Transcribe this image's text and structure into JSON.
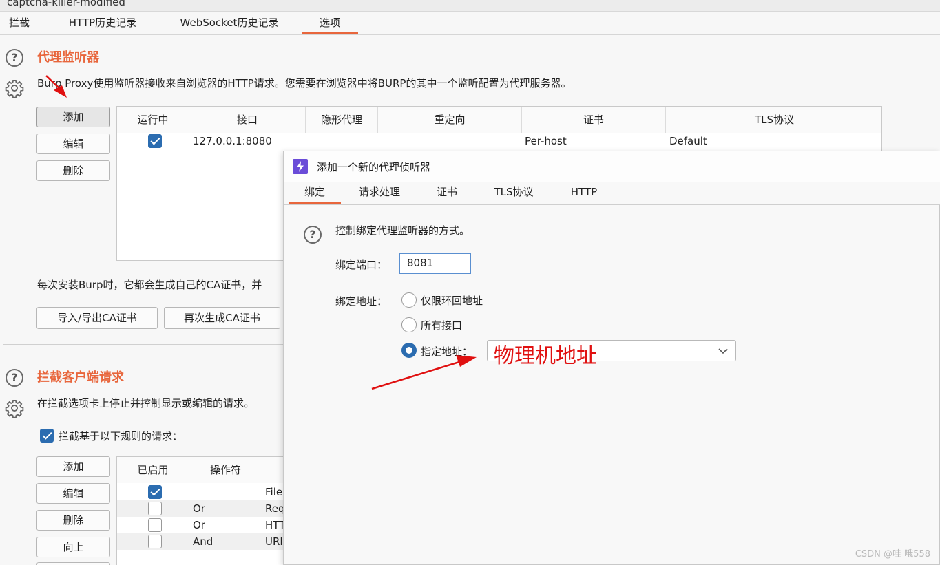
{
  "window_title": "captcha-killer-modified",
  "main_tabs": [
    "拦截",
    "HTTP历史记录",
    "WebSocket历史记录",
    "选项"
  ],
  "proxy_listeners": {
    "title": "代理监听器",
    "desc": "Burp Proxy使用监听器接收来自浏览器的HTTP请求。您需要在浏览器中将BURP的其中一个监听配置为代理服务器。",
    "buttons": {
      "add": "添加",
      "edit": "编辑",
      "delete": "删除"
    },
    "columns": [
      "运行中",
      "接口",
      "隐形代理",
      "重定向",
      "证书",
      "TLS协议"
    ],
    "rows": [
      {
        "running": true,
        "interface": "127.0.0.1:8080",
        "invisible": "",
        "redirect": "",
        "cert": "Per-host",
        "tls": "Default"
      }
    ],
    "ca_desc": "每次安装Burp时，它都会生成自己的CA证书，并",
    "import_export_label": "导入/导出CA证书",
    "regen_label": "再次生成CA证书"
  },
  "intercept_client": {
    "title": "拦截客户端请求",
    "desc": "在拦截选项卡上停止并控制显示或编辑的请求。",
    "checkbox_label": "拦截基于以下规则的请求：",
    "checkbox_checked": true,
    "buttons": {
      "add": "添加",
      "edit": "编辑",
      "delete": "删除",
      "up": "向上"
    },
    "columns": [
      "已启用",
      "操作符"
    ],
    "rows": [
      {
        "enabled": true,
        "op": "",
        "match": "File"
      },
      {
        "enabled": false,
        "op": "Or",
        "match": "Req"
      },
      {
        "enabled": false,
        "op": "Or",
        "match": "HTT"
      },
      {
        "enabled": false,
        "op": "And",
        "match": "URI"
      }
    ]
  },
  "dialog": {
    "title": "添加一个新的代理侦听器",
    "tabs": [
      "绑定",
      "请求处理",
      "证书",
      "TLS协议",
      "HTTP"
    ],
    "desc": "控制绑定代理监听器的方式。",
    "port_label": "绑定端口：",
    "port_value": "8081",
    "addr_label": "绑定地址：",
    "radio_options": [
      "仅限环回地址",
      "所有接口",
      "指定地址："
    ],
    "selected_option": "指定地址：",
    "select_value": ""
  },
  "annotation": "物理机地址",
  "watermark": "CSDN @哇 哦558",
  "colors": {
    "accent": "#e8663c",
    "check_blue": "#2b6cb0",
    "annotation_red": "#e01010"
  }
}
